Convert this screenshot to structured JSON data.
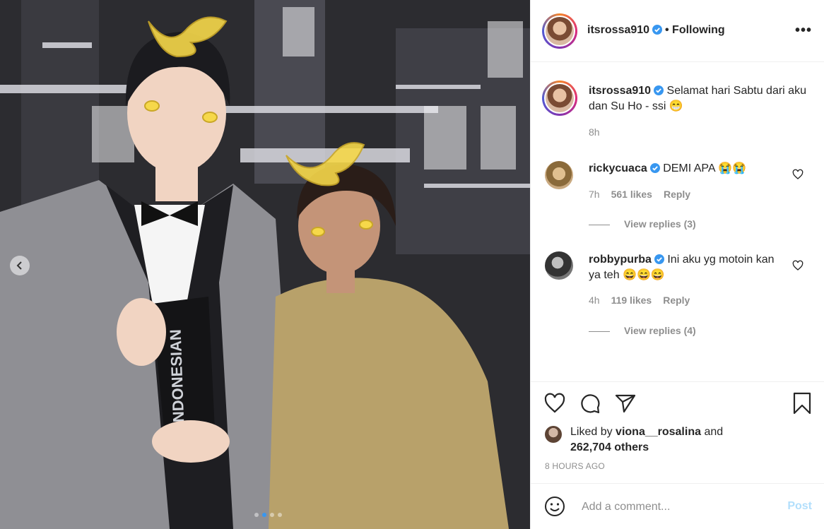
{
  "post": {
    "username": "itsrossa910",
    "follow_status": "• Following",
    "more_label": "•••",
    "photo_alt": "INDONESIAN",
    "carousel": {
      "count": 4,
      "active": 1
    }
  },
  "caption": {
    "username": "itsrossa910",
    "text": "Selamat hari Sabtu dari aku dan Su Ho - ssi 😁",
    "time": "8h"
  },
  "comments": [
    {
      "username": "rickycuaca",
      "text": "DEMI APA 😭😭",
      "time": "7h",
      "likes": "561 likes",
      "reply_label": "Reply",
      "view_replies": "View replies (3)"
    },
    {
      "username": "robbypurba",
      "text": "Ini aku yg motoin kan ya teh 😄😄😄",
      "time": "4h",
      "likes": "119 likes",
      "reply_label": "Reply",
      "view_replies": "View replies (4)"
    }
  ],
  "likes": {
    "prefix": "Liked by",
    "first_user": "viona__rosalina",
    "connector": "and",
    "others": "262,704 others"
  },
  "posted_ago": "8 HOURS AGO",
  "composer": {
    "placeholder": "Add a comment...",
    "post_label": "Post"
  },
  "icons": {
    "like": "heart-icon",
    "comment": "comment-icon",
    "share": "paper-plane-icon",
    "save": "bookmark-icon",
    "emoji": "smiley-icon",
    "verified": "verified-badge-icon"
  },
  "colors": {
    "verified_blue": "#3897f0",
    "post_disabled": "#b2dffc",
    "muted": "#8e8e8e"
  }
}
